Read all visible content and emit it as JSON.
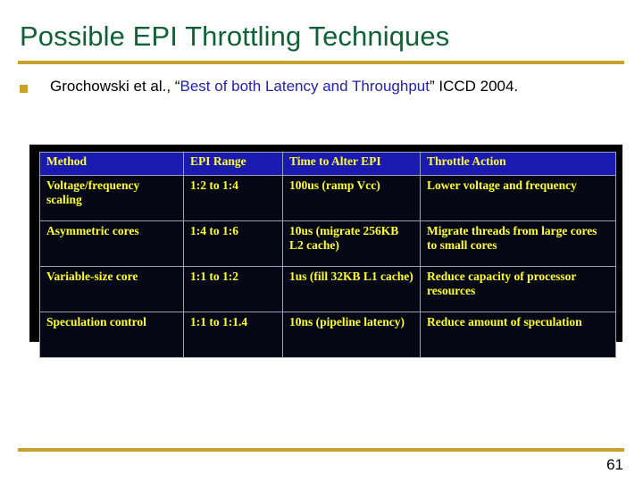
{
  "slide": {
    "title": "Possible EPI Throttling Techniques",
    "page_number": "61",
    "accent_rule_color": "#c9a22b",
    "title_color": "#116137"
  },
  "bullet": {
    "marker": "square-bullet",
    "prefix": "Grochowski et al., ",
    "open_quote": "“",
    "quoted_title": "Best of both Latency and Throughput",
    "close_quote": "”",
    "suffix": " ICCD 2004.",
    "quote_color": "#2222ab"
  },
  "table": {
    "header_bg": "#1a1ab0",
    "body_bg": "#050814",
    "text_color": "#ffff33",
    "border_color": "#9aa0b4",
    "columns": [
      "Method",
      "EPI Range",
      "Time to Alter EPI",
      "Throttle Action"
    ],
    "rows": [
      {
        "method": "Voltage/frequency scaling",
        "epi_range": "1:2 to 1:4",
        "time_to_alter": "100us (ramp Vcc)",
        "throttle_action": "Lower voltage and frequency"
      },
      {
        "method": "Asymmetric cores",
        "epi_range": "1:4 to 1:6",
        "time_to_alter": "10us (migrate 256KB L2 cache)",
        "throttle_action": "Migrate threads from large cores to small cores"
      },
      {
        "method": "Variable-size core",
        "epi_range": "1:1 to 1:2",
        "time_to_alter": "1us (fill 32KB L1 cache)",
        "throttle_action": "Reduce capacity of processor resources"
      },
      {
        "method": "Speculation control",
        "epi_range": "1:1 to 1:1.4",
        "time_to_alter": "10ns (pipeline latency)",
        "throttle_action": "Reduce amount of speculation"
      }
    ]
  }
}
